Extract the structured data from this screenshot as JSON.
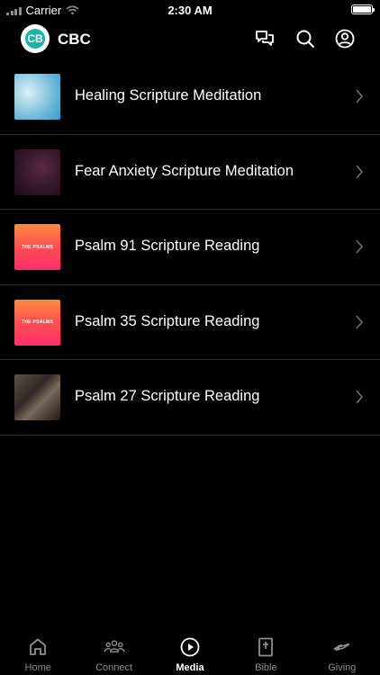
{
  "status_bar": {
    "carrier": "Carrier",
    "time": "2:30 AM",
    "icons": [
      "signal-icon",
      "wifi-icon",
      "battery-icon"
    ]
  },
  "header": {
    "logo_text": "CB",
    "title": "CBC",
    "icons": [
      "chat-icon",
      "search-icon",
      "account-icon"
    ]
  },
  "media_items": [
    {
      "title": "Healing Scripture Meditation",
      "thumbnail": "sky"
    },
    {
      "title": "Fear Anxiety Scripture Meditation",
      "thumbnail": "nebula"
    },
    {
      "title": "Psalm 91 Scripture Reading",
      "thumbnail": "psalms",
      "thumbnail_text": "THE PSALMS"
    },
    {
      "title": "Psalm 35 Scripture Reading",
      "thumbnail": "psalms",
      "thumbnail_text": "THE PSALMS"
    },
    {
      "title": "Psalm 27 Scripture Reading",
      "thumbnail": "photo"
    }
  ],
  "tabs": [
    {
      "label": "Home",
      "icon": "home-icon",
      "active": false
    },
    {
      "label": "Connect",
      "icon": "people-icon",
      "active": false
    },
    {
      "label": "Media",
      "icon": "play-icon",
      "active": true
    },
    {
      "label": "Bible",
      "icon": "bible-icon",
      "active": false
    },
    {
      "label": "Giving",
      "icon": "giving-hand-icon",
      "active": false
    }
  ],
  "colors": {
    "background": "#000000",
    "divider": "#2c2c2e",
    "inactive_tab": "#8e8e93",
    "logo_accent": "#18b4a8"
  }
}
